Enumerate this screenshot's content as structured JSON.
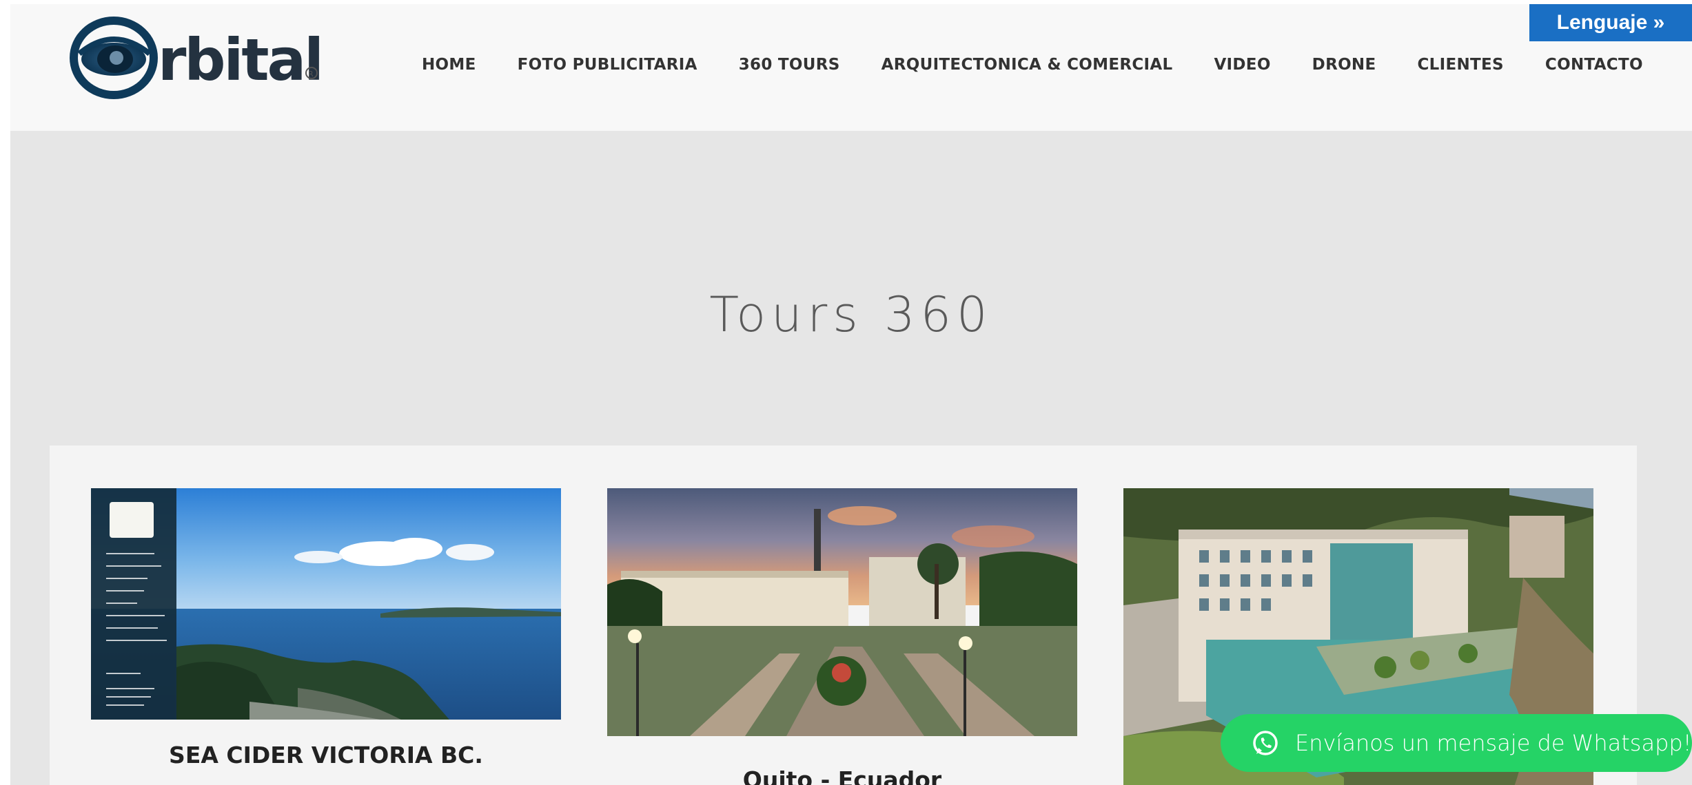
{
  "brand": {
    "name": "Orbital",
    "trademark": "®"
  },
  "nav": {
    "items": [
      {
        "label": "HOME"
      },
      {
        "label": "FOTO PUBLICITARIA"
      },
      {
        "label": "360 TOURS"
      },
      {
        "label": "ARQUITECTONICA & COMERCIAL"
      },
      {
        "label": "VIDEO"
      },
      {
        "label": "DRONE"
      },
      {
        "label": "CLIENTES"
      },
      {
        "label": "CONTACTO"
      }
    ]
  },
  "language_button": {
    "label": "Lenguaje »"
  },
  "page_title": "Tours 360",
  "cards": [
    {
      "caption": "SEA CIDER VICTORIA BC."
    },
    {
      "caption": "Quito - Ecuador"
    },
    {
      "caption": ""
    }
  ],
  "whatsapp": {
    "label": "Envíanos un mensaje de Whatsapp!"
  },
  "colors": {
    "accent_blue": "#1a6fc4",
    "whatsapp_green": "#25d366",
    "header_bg": "#f8f8f8",
    "page_bg": "#e6e6e6"
  },
  "icons": {
    "logo": "orbital-eye-logo",
    "whatsapp": "whatsapp-icon"
  }
}
